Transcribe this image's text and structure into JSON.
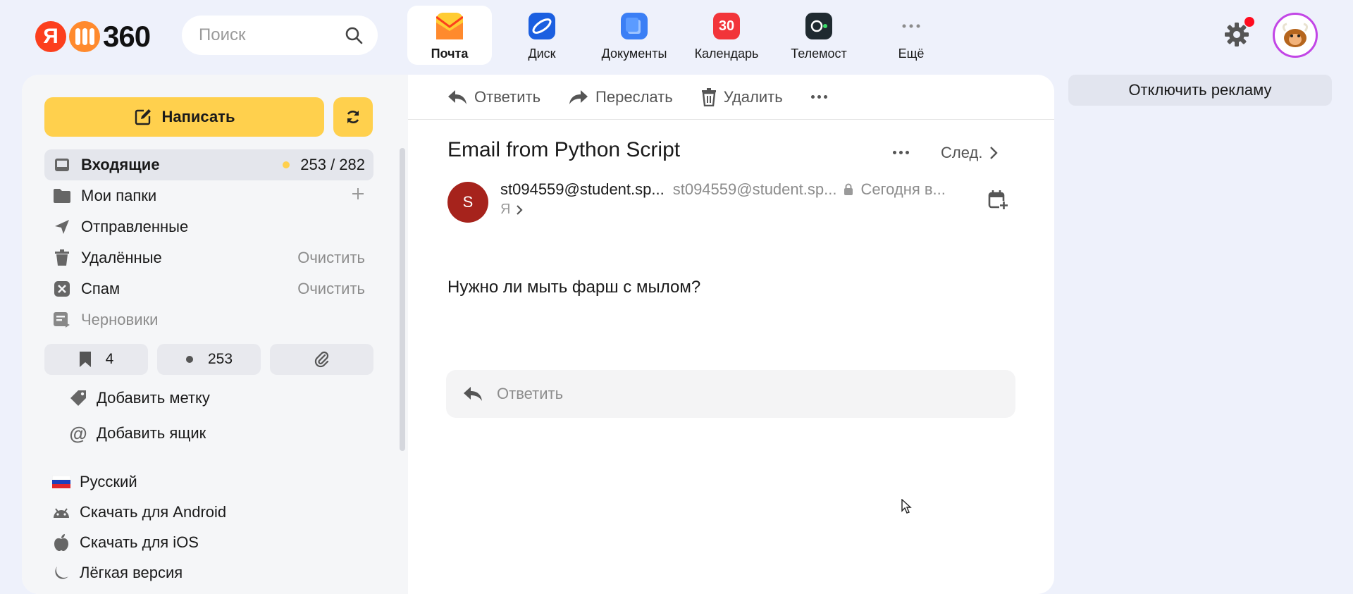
{
  "header": {
    "logo_ya": "Я",
    "logo_text": "360",
    "search_placeholder": "Поиск",
    "apps": [
      {
        "label": "Почта",
        "icon": "mail-icon",
        "active": true
      },
      {
        "label": "Диск",
        "icon": "disk-icon"
      },
      {
        "label": "Документы",
        "icon": "documents-icon"
      },
      {
        "label": "Календарь",
        "icon": "calendar-icon",
        "badge": "30"
      },
      {
        "label": "Телемост",
        "icon": "telemost-icon"
      },
      {
        "label": "Ещё",
        "icon": "more-icon"
      }
    ]
  },
  "sidebar": {
    "compose_label": "Написать",
    "folders": [
      {
        "label": "Входящие",
        "count": "253 / 282",
        "icon": "inbox-icon"
      },
      {
        "label": "Мои папки",
        "icon": "folder-icon"
      },
      {
        "label": "Отправленные",
        "icon": "sent-icon"
      },
      {
        "label": "Удалённые",
        "action": "Очистить",
        "icon": "trash-icon"
      },
      {
        "label": "Спам",
        "action": "Очистить",
        "icon": "spam-icon"
      },
      {
        "label": "Черновики",
        "icon": "drafts-icon"
      }
    ],
    "chips": {
      "bookmarks": "4",
      "unread": "253"
    },
    "add_label": "Добавить метку",
    "add_mailbox": "Добавить ящик",
    "language": "Русский",
    "download_android": "Скачать для Android",
    "download_ios": "Скачать для iOS",
    "light_version": "Лёгкая версия"
  },
  "toolbar": {
    "reply": "Ответить",
    "forward": "Переслать",
    "delete": "Удалить"
  },
  "message": {
    "subject": "Email from Python Script",
    "next_label": "След.",
    "sender_initial": "S",
    "sender_name": "st094559@student.sp...",
    "sender_email": "st094559@student.sp...",
    "date": "Сегодня в...",
    "to": "Я",
    "body": "Нужно ли мыть фарш с мылом?",
    "reply_placeholder": "Ответить"
  },
  "right": {
    "disable_ads": "Отключить рекламу"
  },
  "colors": {
    "accent_yellow": "#ffd04d",
    "background": "#eef1fb",
    "sender_avatar": "#a6231c"
  }
}
